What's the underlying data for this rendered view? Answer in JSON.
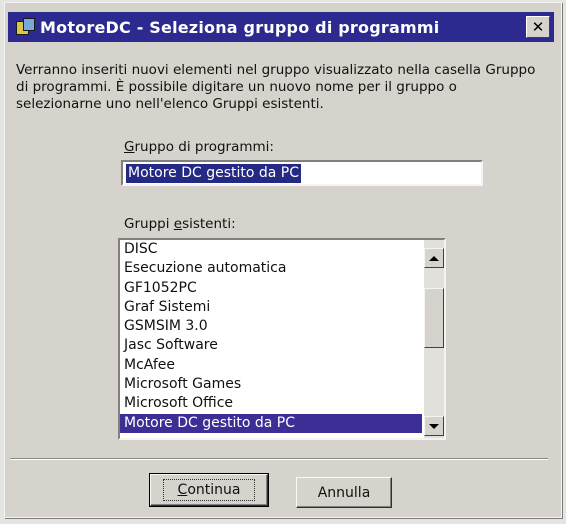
{
  "window": {
    "title": "MotoreDC - Seleziona gruppo di programmi",
    "close_symbol": "✕",
    "icon": "program-group-icon"
  },
  "description": "Verranno inseriti nuovi elementi nel gruppo visualizzato nella casella Gruppo di programmi. È possibile digitare un nuovo nome per il gruppo o selezionarne uno nell'elenco Gruppi esistenti.",
  "program_group": {
    "label_pre": "",
    "label_accel": "G",
    "label_post": "ruppo di programmi:",
    "value": "Motore DC gestito da PC"
  },
  "existing_groups": {
    "label_pre": "Gruppi ",
    "label_accel": "e",
    "label_post": "sistenti:",
    "items": [
      "DISC",
      "Esecuzione automatica",
      "GF1052PC",
      "Graf Sistemi",
      "GSMSIM 3.0",
      "Jasc Software",
      "McAfee",
      "Microsoft Games",
      "Microsoft Office",
      "Motore DC gestito da PC"
    ],
    "selected_index": 9
  },
  "buttons": {
    "continue_accel": "C",
    "continue_rest": "ontinua",
    "cancel": "Annulla"
  },
  "colors": {
    "titlebar": "#2c2a8f",
    "selection": "#3b2f96",
    "face": "#d6d3cc"
  }
}
